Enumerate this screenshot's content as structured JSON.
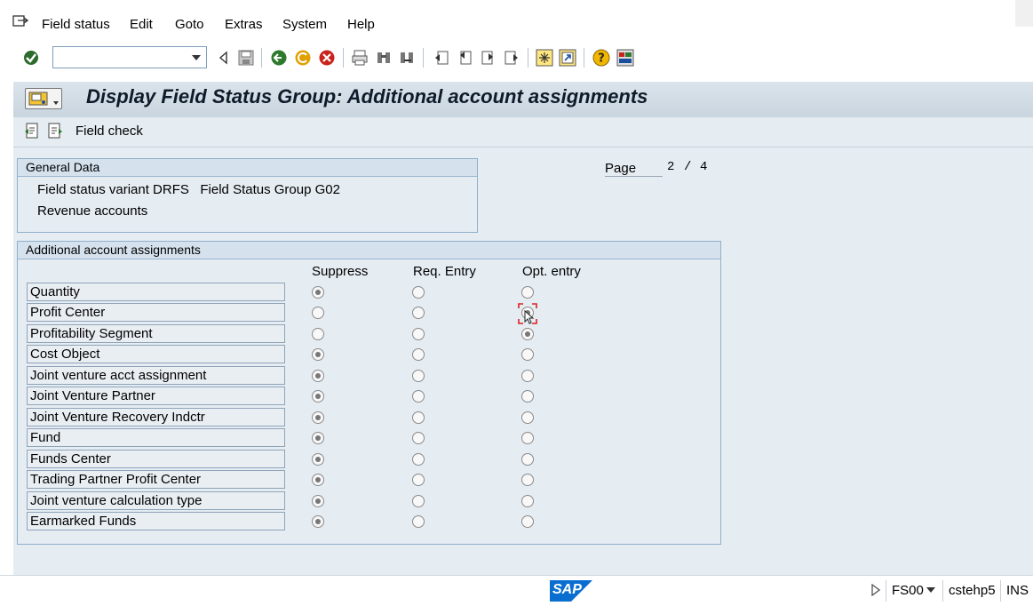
{
  "menu": {
    "items": [
      "Field status",
      "Edit",
      "Goto",
      "Extras",
      "System",
      "Help"
    ]
  },
  "toolbar": {
    "command_value": "",
    "icons": [
      "enter-icon",
      "back-icon",
      "save-icon",
      "back-green-icon",
      "exit-icon",
      "cancel-icon",
      "print-icon",
      "find-icon",
      "find-next-icon",
      "first-page-icon",
      "prev-page-icon",
      "next-page-icon",
      "last-page-icon",
      "create-session-icon",
      "shortcut-icon",
      "help-icon",
      "layout-icon"
    ]
  },
  "title": "Display Field Status Group: Additional account assignments",
  "app_toolbar": {
    "field_check_label": "Field check"
  },
  "general_data": {
    "header": "General Data",
    "line1": "Field status variant DRFS   Field Status Group G02",
    "line2": "Revenue accounts"
  },
  "page": {
    "label": "Page",
    "current": "2",
    "sep": "/",
    "total": "4"
  },
  "assignments": {
    "header": "Additional account assignments",
    "col_suppress": "Suppress",
    "col_req": "Req. Entry",
    "col_opt": "Opt. entry",
    "rows": [
      {
        "label": "Quantity",
        "selected": "suppress"
      },
      {
        "label": "Profit Center",
        "selected": "opt"
      },
      {
        "label": "Profitability Segment",
        "selected": "opt"
      },
      {
        "label": "Cost Object",
        "selected": "suppress"
      },
      {
        "label": "Joint venture acct assignment",
        "selected": "suppress"
      },
      {
        "label": "Joint Venture Partner",
        "selected": "suppress"
      },
      {
        "label": "Joint Venture Recovery Indctr",
        "selected": "suppress"
      },
      {
        "label": "Fund",
        "selected": "suppress"
      },
      {
        "label": "Funds Center",
        "selected": "suppress"
      },
      {
        "label": "Trading Partner Profit Center",
        "selected": "suppress"
      },
      {
        "label": "Joint venture calculation type",
        "selected": "suppress"
      },
      {
        "label": "Earmarked Funds",
        "selected": "suppress"
      }
    ]
  },
  "status": {
    "logo": "SAP",
    "transaction": "FS00",
    "server": "cstehp5",
    "mode": "INS"
  },
  "colors": {
    "accent_blue": "#0a6ed1",
    "panel_bg": "#e5ecf2"
  }
}
